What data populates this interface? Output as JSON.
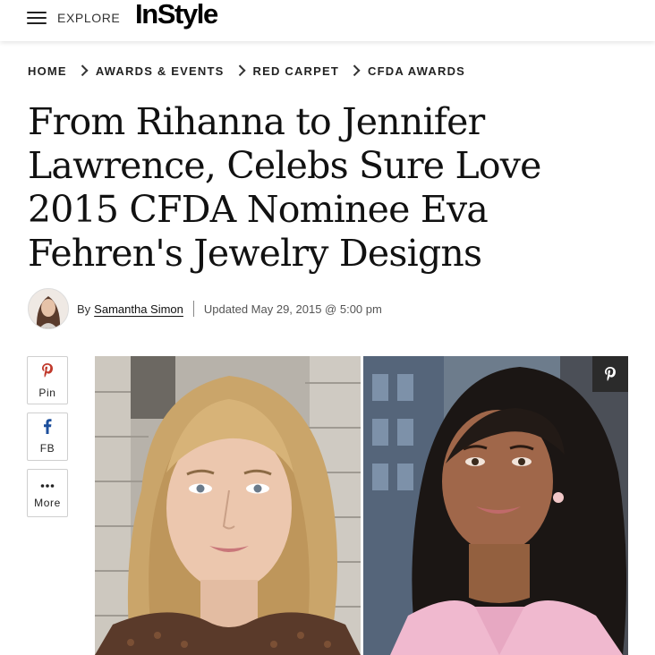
{
  "header": {
    "explore_label": "EXPLORE",
    "logo_text": "InStyle"
  },
  "breadcrumb": [
    {
      "label": "HOME"
    },
    {
      "label": "AWARDS & EVENTS"
    },
    {
      "label": "RED CARPET"
    },
    {
      "label": "CFDA AWARDS"
    }
  ],
  "article": {
    "headline": "From Rihanna to Jennifer Lawrence, Celebs Sure Love 2015 CFDA Nominee Eva Fehren's Jewelry Designs",
    "by_label": "By",
    "author": "Samantha Simon",
    "updated": "Updated May 29, 2015 @ 5:00 pm"
  },
  "share": {
    "pin_label": "Pin",
    "fb_label": "FB",
    "more_label": "More"
  },
  "photo": {
    "left_subject": "blonde-woman-portrait",
    "right_subject": "dark-haired-woman-portrait",
    "pin_icon": "pinterest-icon"
  },
  "colors": {
    "text": "#111111",
    "pin_overlay": "#2b2b2b",
    "border": "#cfcfcf"
  }
}
